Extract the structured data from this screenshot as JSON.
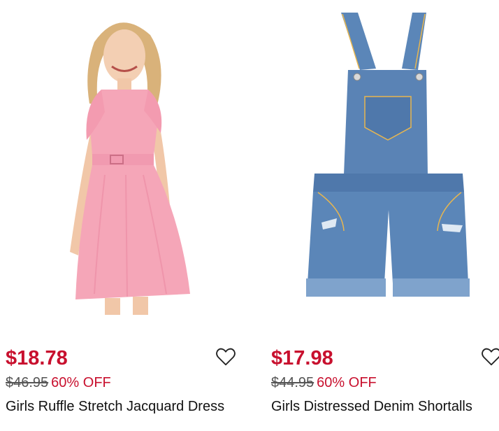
{
  "products": [
    {
      "price": "$18.78",
      "original_price": "$46.95",
      "discount": "60% OFF",
      "title": "Girls Ruffle Stretch Jacquard Dress",
      "colors": {
        "sale": "#c8102e",
        "garment": "#f5a6b8"
      }
    },
    {
      "price": "$17.98",
      "original_price": "$44.95",
      "discount": "60% OFF",
      "title": "Girls Distressed Denim Shortalls",
      "colors": {
        "sale": "#c8102e",
        "garment": "#5b86b8"
      }
    }
  ],
  "icons": {
    "favorite": "heart-outline-icon"
  }
}
